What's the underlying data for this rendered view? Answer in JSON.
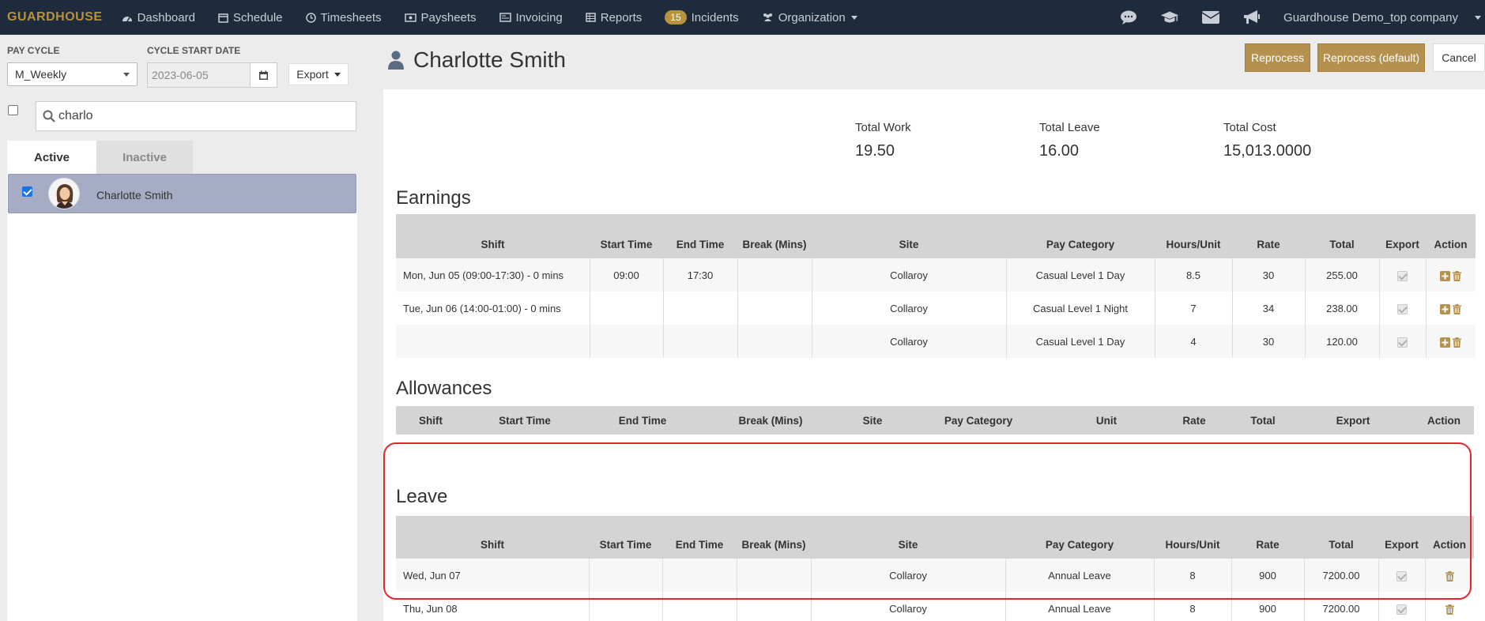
{
  "nav": {
    "brand": "GUARDHOUSE",
    "items": [
      {
        "label": "Dashboard",
        "icon": "dashboard-icon"
      },
      {
        "label": "Schedule",
        "icon": "calendar-icon"
      },
      {
        "label": "Timesheets",
        "icon": "clock-icon"
      },
      {
        "label": "Paysheets",
        "icon": "money-icon"
      },
      {
        "label": "Invoicing",
        "icon": "invoice-icon"
      },
      {
        "label": "Reports",
        "icon": "table-icon"
      }
    ],
    "incidents_badge": "15",
    "incidents_label": "Incidents",
    "organization_label": "Organization",
    "right_icons": [
      "chat-icon",
      "graduation-cap-icon",
      "envelope-icon",
      "megaphone-icon"
    ],
    "company": "Guardhouse Demo_top company"
  },
  "left": {
    "pay_cycle_label": "PAY CYCLE",
    "pay_cycle_value": "M_Weekly",
    "cycle_start_label": "CYCLE START DATE",
    "cycle_start_value": "2023-06-05",
    "export_label": "Export",
    "search_value": "charlo",
    "tab_active": "Active",
    "tab_inactive": "Inactive",
    "employee": "Charlotte Smith"
  },
  "header": {
    "employee_name": "Charlotte Smith",
    "reprocess": "Reprocess",
    "reprocess_default": "Reprocess (default)",
    "cancel": "Cancel"
  },
  "totals": {
    "work_label": "Total Work",
    "work_value": "19.50",
    "leave_label": "Total Leave",
    "leave_value": "16.00",
    "cost_label": "Total Cost",
    "cost_value": "15,013.0000"
  },
  "earnings": {
    "title": "Earnings",
    "columns": [
      "Shift",
      "Start Time",
      "End Time",
      "Break (Mins)",
      "Site",
      "Pay Category",
      "Hours/Unit",
      "Rate",
      "Total",
      "Export",
      "Action"
    ],
    "rows": [
      [
        "Mon, Jun 05 (09:00-17:30) - 0 mins",
        "09:00",
        "17:30",
        "",
        "Collaroy",
        "Casual Level 1 Day",
        "8.5",
        "30",
        "255.00"
      ],
      [
        "Tue, Jun 06 (14:00-01:00) - 0 mins",
        "",
        "",
        "",
        "Collaroy",
        "Casual Level 1 Night",
        "7",
        "34",
        "238.00"
      ],
      [
        "",
        "",
        "",
        "",
        "Collaroy",
        "Casual Level 1 Day",
        "4",
        "30",
        "120.00"
      ]
    ]
  },
  "allowances": {
    "title": "Allowances",
    "columns": [
      "Shift",
      "Start Time",
      "End Time",
      "Break (Mins)",
      "Site",
      "Pay Category",
      "Unit",
      "Rate",
      "Total",
      "Export",
      "Action"
    ]
  },
  "leave": {
    "title": "Leave",
    "columns": [
      "Shift",
      "Start Time",
      "End Time",
      "Break (Mins)",
      "Site",
      "Pay Category",
      "Hours/Unit",
      "Rate",
      "Total",
      "Export",
      "Action"
    ],
    "rows": [
      [
        "Wed, Jun 07",
        "",
        "",
        "",
        "Collaroy",
        "Annual Leave",
        "8",
        "900",
        "7200.00"
      ],
      [
        "Thu, Jun 08",
        "",
        "",
        "",
        "Collaroy",
        "Annual Leave",
        "8",
        "900",
        "7200.00"
      ]
    ]
  }
}
